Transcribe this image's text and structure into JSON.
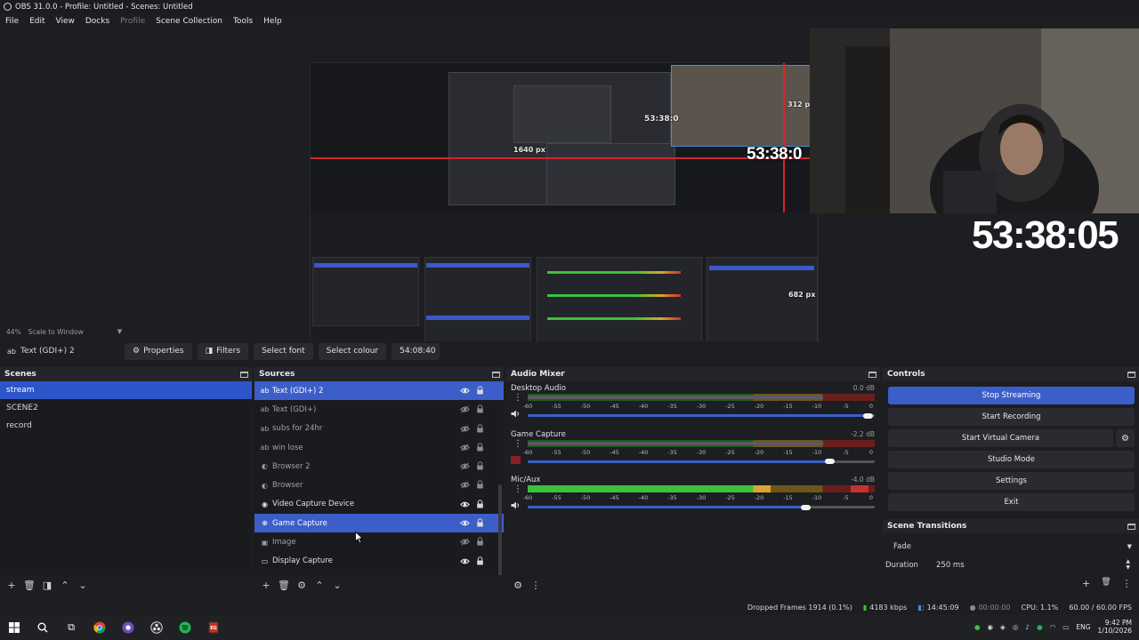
{
  "window": {
    "title": "OBS 31.0.0 - Profile: Untitled - Scenes: Untitled"
  },
  "menu": [
    "File",
    "Edit",
    "View",
    "Docks",
    "Profile",
    "Scene Collection",
    "Tools",
    "Help"
  ],
  "preview": {
    "nested_timer": "53:38:05",
    "nested_timer_small": "53:38:0",
    "px_labels": [
      "1640 px",
      "312 px",
      "682 px"
    ],
    "timer_overlay": "53:38:05"
  },
  "zoom": {
    "level": "44%",
    "mode": "Scale to Window"
  },
  "context_bar": {
    "source": "Text (GDI+) 2",
    "properties": "Properties",
    "filters": "Filters",
    "select_font": "Select font",
    "select_colour": "Select colour",
    "text_value": "54:08:40"
  },
  "scenes": {
    "title": "Scenes",
    "items": [
      "stream",
      "SCENE2",
      "record"
    ]
  },
  "sources": {
    "title": "Sources",
    "items": [
      {
        "label": "Text (GDI+) 2",
        "icon": "text-icon",
        "visible": true
      },
      {
        "label": "Text (GDI+)",
        "icon": "text-icon",
        "visible": false
      },
      {
        "label": "subs for 24hr",
        "icon": "text-icon",
        "visible": false
      },
      {
        "label": "win lose",
        "icon": "text-icon",
        "visible": false
      },
      {
        "label": "Browser 2",
        "icon": "globe-icon",
        "visible": false
      },
      {
        "label": "Browser",
        "icon": "globe-icon",
        "visible": false
      },
      {
        "label": "Video Capture Device",
        "icon": "camera-icon",
        "visible": true
      },
      {
        "label": "Game Capture",
        "icon": "gamepad-icon",
        "visible": true
      },
      {
        "label": "Image",
        "icon": "image-icon",
        "visible": false
      },
      {
        "label": "Display Capture",
        "icon": "monitor-icon",
        "visible": true
      }
    ]
  },
  "mixer": {
    "title": "Audio Mixer",
    "scale": [
      "-60",
      "-55",
      "-50",
      "-45",
      "-40",
      "-35",
      "-30",
      "-25",
      "-20",
      "-15",
      "-10",
      "-5",
      "0"
    ],
    "channels": [
      {
        "name": "Desktop Audio",
        "db": "0.0 dB",
        "level": 0.0,
        "volume": 0.98
      },
      {
        "name": "Game Capture",
        "db": "-2.2 dB",
        "level": 0.0,
        "volume": 0.87
      },
      {
        "name": "Mic/Aux",
        "db": "-4.0 dB",
        "level": 0.7,
        "volume": 0.8
      }
    ]
  },
  "controls": {
    "title": "Controls",
    "buttons": [
      "Stop Streaming",
      "Start Recording",
      "Start Virtual Camera",
      "Studio Mode",
      "Settings",
      "Exit"
    ]
  },
  "transitions": {
    "title": "Scene Transitions",
    "type": "Fade",
    "duration_label": "Duration",
    "duration_value": "250 ms"
  },
  "status": {
    "dropped": "Dropped Frames 1914 (0.1%)",
    "bitrate": "4183 kbps",
    "stream_time": "14:45:09",
    "rec_time": "00:00:00",
    "cpu": "CPU: 1.1%",
    "fps": "60.00 / 60.00 FPS"
  },
  "taskbar": {
    "lang": "ENG",
    "time": "9:42 PM",
    "date": "1/10/2026"
  },
  "colors": {
    "accent": "#3c5ec9",
    "bg": "#1d1e22",
    "meter_green": "#3cc13c",
    "meter_yellow": "#d8a630",
    "meter_red": "#c8322e"
  }
}
